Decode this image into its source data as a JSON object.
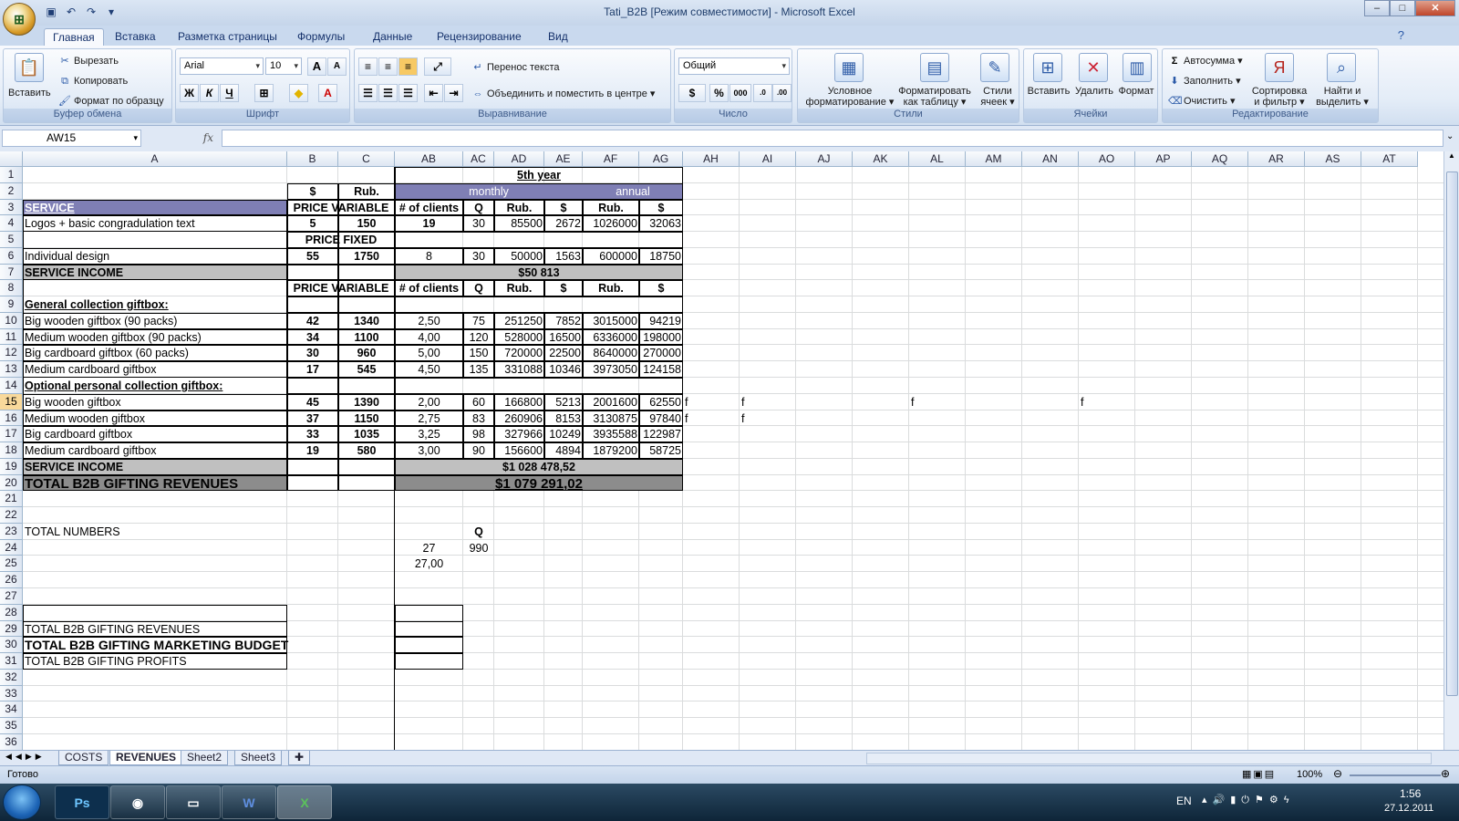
{
  "window": {
    "title": "Tati_B2B  [Режим совместимости] - Microsoft Excel",
    "office_button_glyph": "⊞",
    "min_glyph": "–",
    "max_glyph": "□",
    "close_glyph": "✕"
  },
  "qat": [
    "save-icon",
    "undo-icon",
    "redo-icon",
    "customize-icon"
  ],
  "ribbon_tabs": [
    "Главная",
    "Вставка",
    "Разметка страницы",
    "Формулы",
    "Данные",
    "Рецензирование",
    "Вид"
  ],
  "ribbon": {
    "clipboard": {
      "paste": "Вставить",
      "cut": "Вырезать",
      "copy": "Копировать",
      "format_painter": "Формат по образцу",
      "label": "Буфер обмена"
    },
    "font": {
      "name": "Arial",
      "size": "10",
      "grow": "A",
      "shrink": "A",
      "bold": "Ж",
      "italic": "К",
      "underline": "Ч",
      "label": "Шрифт"
    },
    "alignment": {
      "wrap": "Перенос текста",
      "merge": "Объединить и поместить в центре",
      "label": "Выравнивание"
    },
    "number": {
      "format": "Общий",
      "percent": "%",
      "thousands": "000",
      "label": "Число"
    },
    "styles": {
      "conditional": "Условное\nформатирование",
      "conditional_1": "Условное",
      "conditional_2": "форматирование",
      "table_1": "Форматировать",
      "table_2": "как таблицу",
      "cell_1": "Стили",
      "cell_2": "ячеек",
      "label": "Стили"
    },
    "cells": {
      "insert": "Вставить",
      "delete": "Удалить",
      "format": "Формат",
      "label": "Ячейки"
    },
    "editing": {
      "autosum": "Автосумма",
      "fill": "Заполнить",
      "clear": "Очистить",
      "sort_1": "Сортировка",
      "sort_2": "и фильтр",
      "find_1": "Найти и",
      "find_2": "выделить",
      "label": "Редактирование"
    }
  },
  "formula_bar": {
    "name_box": "AW15",
    "fx": "fx",
    "value": ""
  },
  "columns": [
    "A",
    "B",
    "C",
    "AB",
    "AC",
    "AD",
    "AE",
    "AF",
    "AG",
    "AH",
    "AI",
    "AJ",
    "AK",
    "AL",
    "AM",
    "AN",
    "AO",
    "AP",
    "AQ",
    "AR",
    "AS",
    "AT"
  ],
  "rows": [
    "1",
    "2",
    "3",
    "4",
    "5",
    "6",
    "7",
    "8",
    "9",
    "10",
    "11",
    "12",
    "13",
    "14",
    "15",
    "16",
    "17",
    "18",
    "19",
    "20",
    "21",
    "22",
    "23",
    "24",
    "25",
    "26",
    "27",
    "28",
    "29",
    "30",
    "31",
    "32",
    "33",
    "34",
    "35",
    "36"
  ],
  "cells": {
    "ad1": "5th year",
    "b2": "$",
    "c2": "Rub.",
    "ad2": "monthly",
    "ag2": "annual",
    "a3": "SERVICE",
    "b3": "PRICE VARIABLE",
    "ab3": "# of clients",
    "ac3": "Q",
    "ad3": "Rub.",
    "ae3": "$",
    "af3": "Rub.",
    "ag3": "$",
    "a4": "Logos + basic congradulation text",
    "b4": "5",
    "c4": "150",
    "ab4": "19",
    "ac4": "30",
    "ad4": "85500",
    "ae4": "2672",
    "af4": "1026000",
    "ag4": "32063",
    "b5": "PRICE FIXED",
    "a6": "Individual design",
    "b6": "55",
    "c6": "1750",
    "ab6": "8",
    "ac6": "30",
    "ad6": "50000",
    "ae6": "1563",
    "af6": "600000",
    "ag6": "18750",
    "a7": "SERVICE INCOME",
    "ad7": "$50 813",
    "b8": "PRICE VARIABLE",
    "ab8": "# of clients",
    "ac8": "Q",
    "ad8": "Rub.",
    "ae8": "$",
    "af8": "Rub.",
    "ag8": "$",
    "a9": "General collection giftbox:",
    "a10": "Big wooden giftbox (90 packs)",
    "b10": "42",
    "c10": "1340",
    "ab10": "2,50",
    "ac10": "75",
    "ad10": "251250",
    "ae10": "7852",
    "af10": "3015000",
    "ag10": "94219",
    "a11": "Medium wooden giftbox (90 packs)",
    "b11": "34",
    "c11": "1100",
    "ab11": "4,00",
    "ac11": "120",
    "ad11": "528000",
    "ae11": "16500",
    "af11": "6336000",
    "ag11": "198000",
    "a12": "Big cardboard giftbox (60 packs)",
    "b12": "30",
    "c12": "960",
    "ab12": "5,00",
    "ac12": "150",
    "ad12": "720000",
    "ae12": "22500",
    "af12": "8640000",
    "ag12": "270000",
    "a13": "Medium cardboard giftbox",
    "b13": "17",
    "c13": "545",
    "ab13": "4,50",
    "ac13": "135",
    "ad13": "331088",
    "ae13": "10346",
    "af13": "3973050",
    "ag13": "124158",
    "a14": "Optional personal collection giftbox:",
    "a15": "Big wooden giftbox",
    "b15": "45",
    "c15": "1390",
    "ab15": "2,00",
    "ac15": "60",
    "ad15": "166800",
    "ae15": "5213",
    "af15": "2001600",
    "ag15": "62550",
    "a16": "Medium wooden giftbox",
    "b16": "37",
    "c16": "1150",
    "ab16": "2,75",
    "ac16": "83",
    "ad16": "260906",
    "ae16": "8153",
    "af16": "3130875",
    "ag16": "97840",
    "a17": "Big cardboard giftbox",
    "b17": "33",
    "c17": "1035",
    "ab17": "3,25",
    "ac17": "98",
    "ad17": "327966",
    "ae17": "10249",
    "af17": "3935588",
    "ag17": "122987",
    "a18": "Medium cardboard giftbox",
    "b18": "19",
    "c18": "580",
    "ab18": "3,00",
    "ac18": "90",
    "ad18": "156600",
    "ae18": "4894",
    "af18": "1879200",
    "ag18": "58725",
    "a19": "SERVICE INCOME",
    "ad19": "$1 028 478,52",
    "a20": "TOTAL B2B GIFTING REVENUES",
    "ad20": "$1 079 291,02",
    "a23": "TOTAL NUMBERS",
    "ac23": "Q",
    "ab24": "27",
    "ac24": "990",
    "ab25": "27,00",
    "a29": "TOTAL B2B GIFTING REVENUES",
    "a30": "TOTAL B2B GIFTING MARKETING BUDGET",
    "a31": "TOTAL B2B GIFTING PROFITS",
    "ah15": "f",
    "ai15": "f",
    "al15": "f",
    "ao15": "f",
    "ah16": "f",
    "ai16": "f"
  },
  "sheet_tabs": [
    "COSTS",
    "REVENUES",
    "Sheet2",
    "Sheet3"
  ],
  "status": {
    "ready": "Готово",
    "zoom": "100%"
  },
  "taskbar": {
    "lang": "EN",
    "time": "1:56",
    "date": "27.12.2011",
    "apps": [
      "Ps",
      "chrome-icon",
      "explorer-icon",
      "W",
      "X"
    ]
  },
  "colors": {
    "accent": "#7f7fb5",
    "header_gray": "#c0c0c0",
    "total_gray": "#8c8c8c",
    "selected_row": "#f9d99b"
  }
}
